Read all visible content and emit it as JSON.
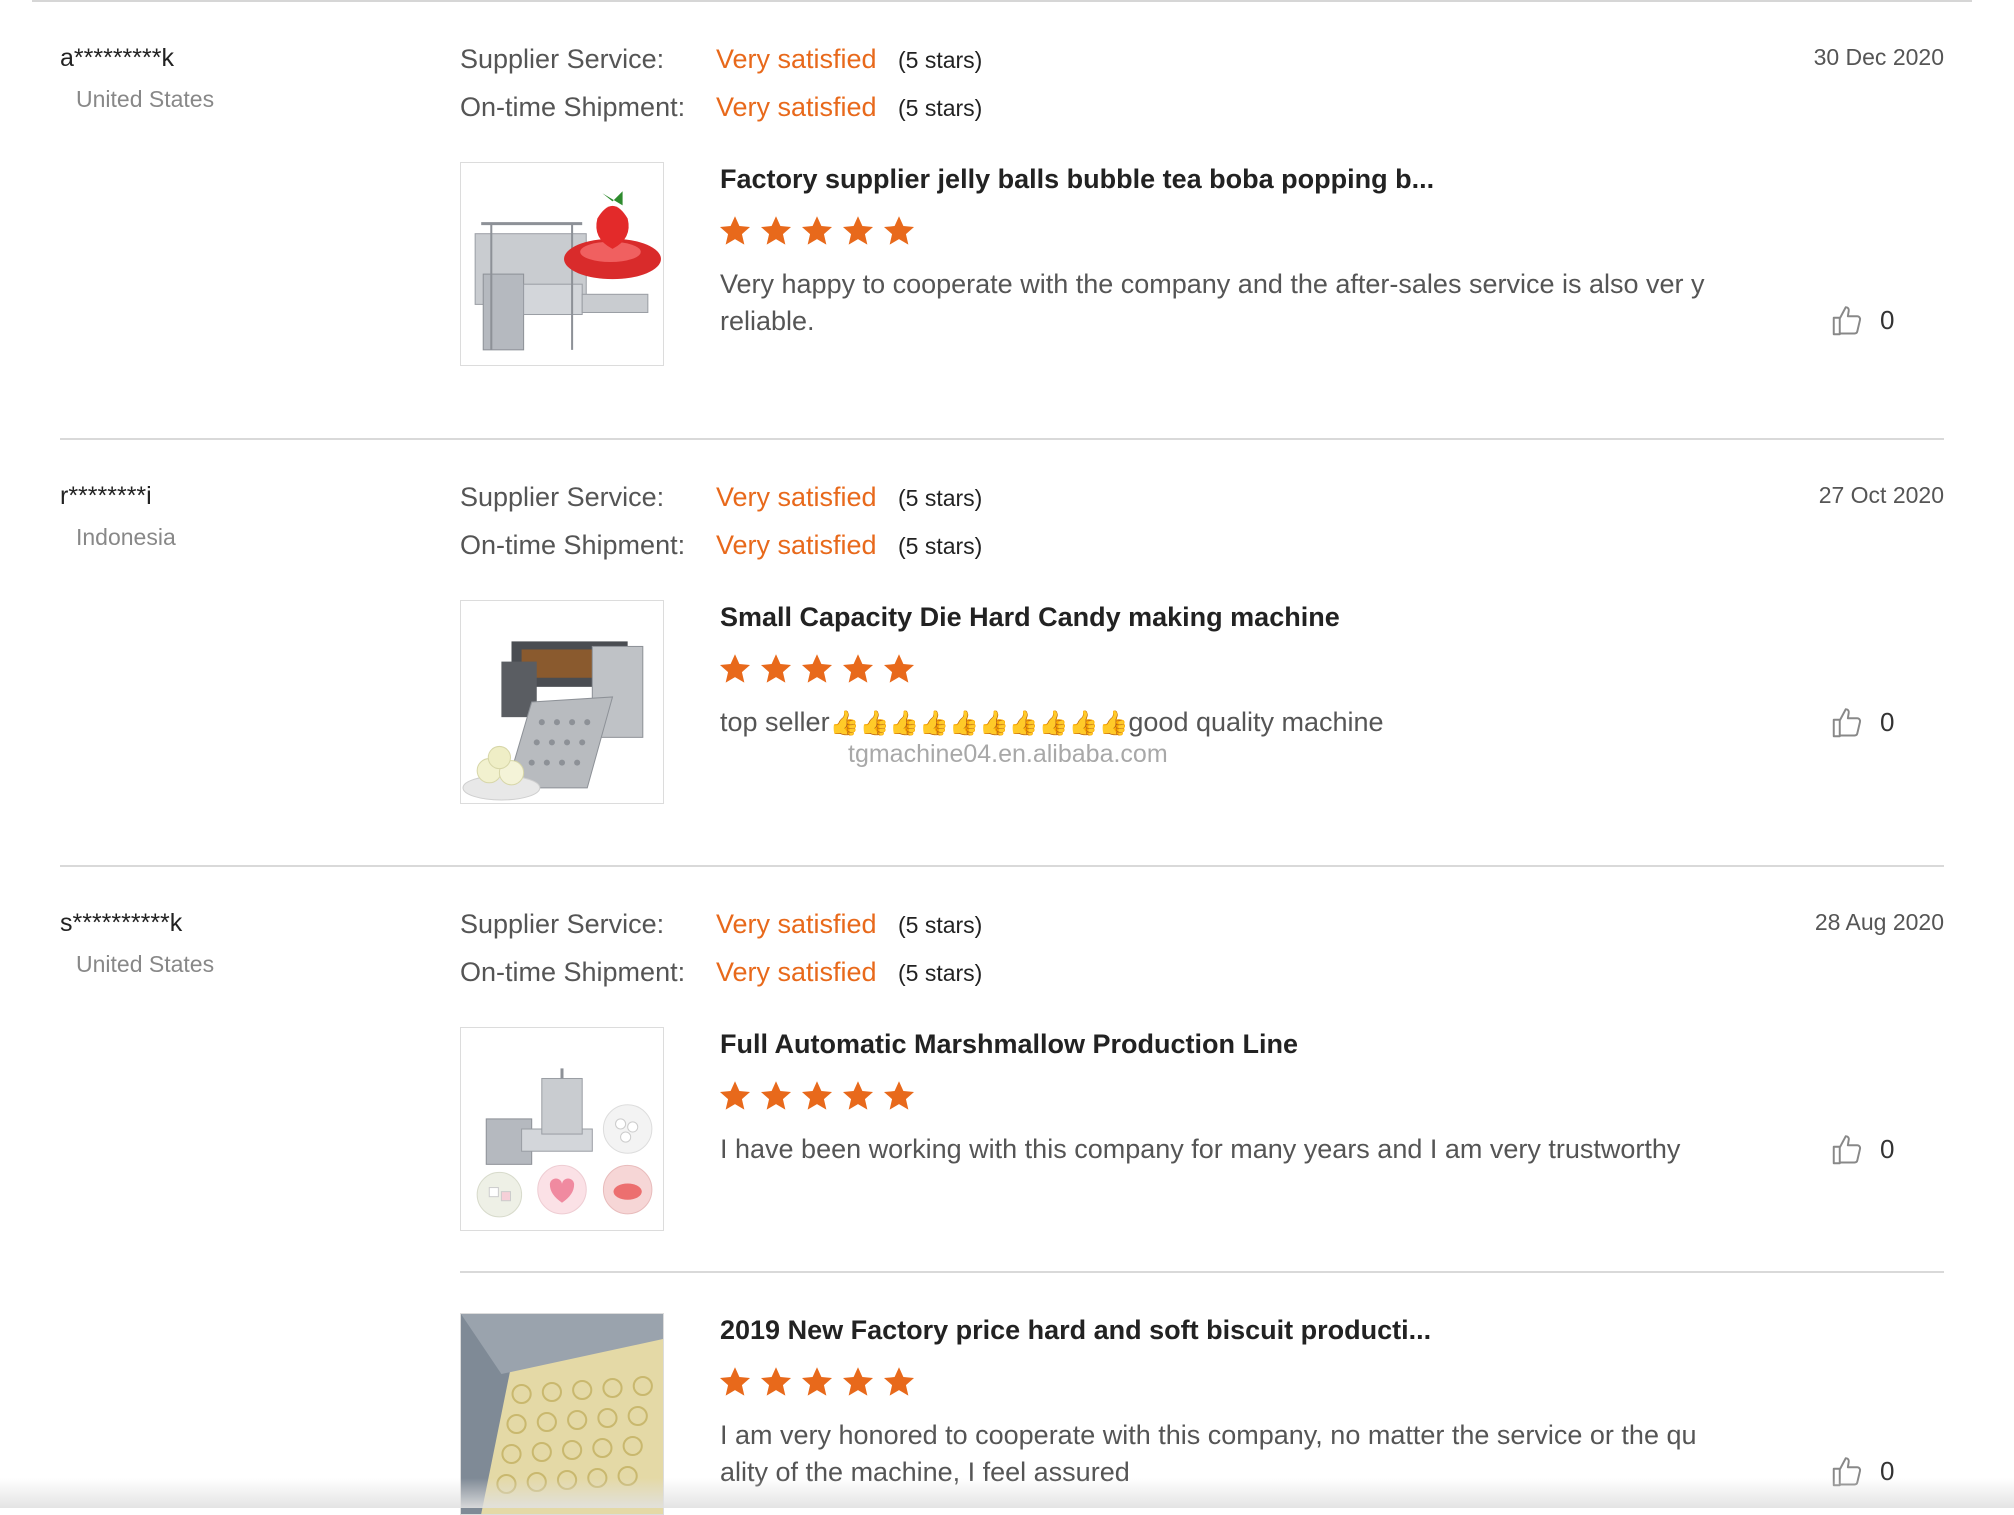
{
  "labels": {
    "supplier_service": "Supplier Service:",
    "on_time_shipment": "On-time Shipment:"
  },
  "colors": {
    "accent": "#e8691b",
    "separator": "#d9d9d9"
  },
  "icons": {
    "star": "star-icon",
    "like": "thumbs-up-icon"
  },
  "reviews": [
    {
      "user": "a*********k",
      "country": "United States",
      "date": "30 Dec 2020",
      "supplier_service": {
        "value": "Very satisfied",
        "stars": "(5 stars)"
      },
      "on_time_shipment": {
        "value": "Very satisfied",
        "stars": "(5 stars)"
      },
      "products": [
        {
          "title": "Factory supplier jelly balls bubble tea boba popping b...",
          "rating": 5,
          "comment": "Very happy to cooperate with the  company and the after-sales service is also ver y reliable.",
          "likes": "0"
        }
      ]
    },
    {
      "user": "r********i",
      "country": "Indonesia",
      "date": "27 Oct 2020",
      "supplier_service": {
        "value": "Very satisfied",
        "stars": "(5 stars)"
      },
      "on_time_shipment": {
        "value": "Very satisfied",
        "stars": "(5 stars)"
      },
      "products": [
        {
          "title": "Small Capacity Die Hard Candy making machine",
          "rating": 5,
          "comment_start": "top seller",
          "comment_emoji": "👍👍👍👍👍👍👍👍👍👍",
          "comment_end": "good quality machine",
          "watermark": "tgmachine04.en.alibaba.com",
          "likes": "0"
        }
      ]
    },
    {
      "user": "s**********k",
      "country": "United States",
      "date": "28 Aug 2020",
      "supplier_service": {
        "value": "Very satisfied",
        "stars": "(5 stars)"
      },
      "on_time_shipment": {
        "value": "Very satisfied",
        "stars": "(5 stars)"
      },
      "products": [
        {
          "title": "Full Automatic Marshmallow Production Line",
          "rating": 5,
          "comment": "I have been working with this company for many years and I am very trustworthy",
          "likes": "0"
        },
        {
          "title": "2019 New Factory price hard and soft biscuit producti...",
          "rating": 5,
          "comment": "I am very honored to cooperate with this company, no matter the service or the qu ality of the machine, I feel assured",
          "likes": "0"
        }
      ]
    }
  ]
}
